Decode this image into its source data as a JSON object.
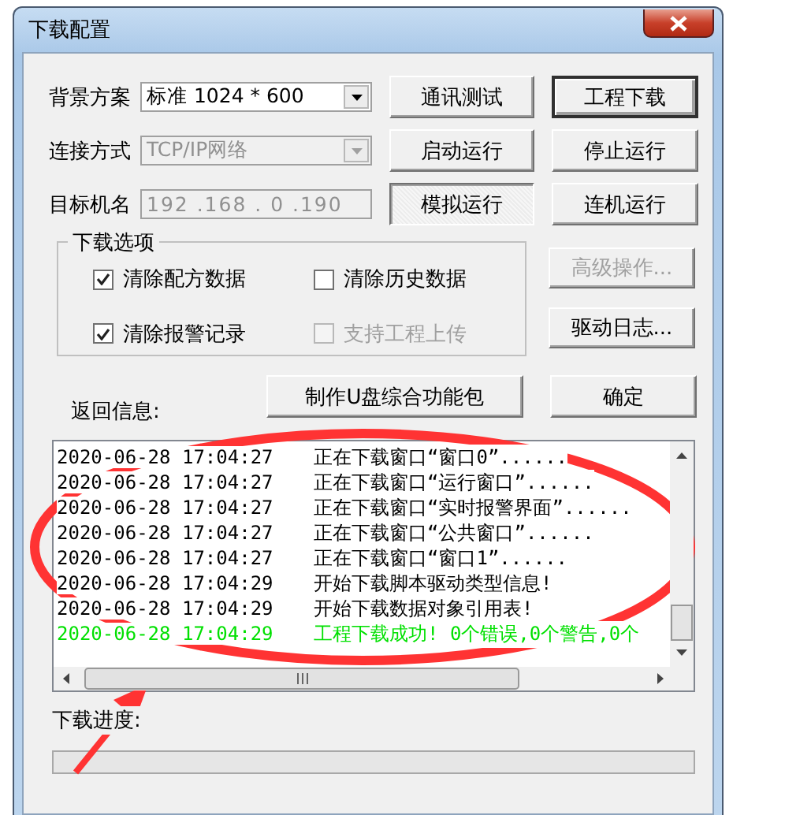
{
  "window": {
    "title": "下载配置"
  },
  "settings": [
    {
      "label": "背景方案",
      "kind": "combo",
      "value": "标准 1024 * 600",
      "disabled": false
    },
    {
      "label": "连接方式",
      "kind": "combo",
      "value": "TCP/IP网络",
      "disabled": true
    },
    {
      "label": "目标机名",
      "kind": "text",
      "value": "192 .168 . 0 .190",
      "disabled": true
    }
  ],
  "action_buttons": [
    {
      "label": "通讯测试",
      "disabled": false,
      "pressed": false,
      "default": false
    },
    {
      "label": "工程下载",
      "disabled": false,
      "pressed": false,
      "default": true
    },
    {
      "label": "启动运行",
      "disabled": false,
      "pressed": false,
      "default": false
    },
    {
      "label": "停止运行",
      "disabled": false,
      "pressed": false,
      "default": false
    },
    {
      "label": "模拟运行",
      "disabled": false,
      "pressed": true,
      "default": false
    },
    {
      "label": "连机运行",
      "disabled": false,
      "pressed": false,
      "default": false
    }
  ],
  "download_options": {
    "title": "下载选项",
    "options": [
      {
        "label": "清除配方数据",
        "checked": true,
        "disabled": false
      },
      {
        "label": "清除历史数据",
        "checked": false,
        "disabled": false
      },
      {
        "label": "清除报警记录",
        "checked": true,
        "disabled": false
      },
      {
        "label": "支持工程上传",
        "checked": false,
        "disabled": true
      }
    ]
  },
  "side_buttons": [
    {
      "label": "高级操作...",
      "disabled": true
    },
    {
      "label": "驱动日志...",
      "disabled": false
    }
  ],
  "usb_button": {
    "label": "制作U盘综合功能包"
  },
  "ok_button": {
    "label": "确定"
  },
  "log": {
    "label": "返回信息:",
    "entries": [
      {
        "time": "2020-06-28 17:04:27",
        "message": "正在下载窗口“窗口0”......",
        "kind": "info"
      },
      {
        "time": "2020-06-28 17:04:27",
        "message": "正在下载窗口“运行窗口”......",
        "kind": "info"
      },
      {
        "time": "2020-06-28 17:04:27",
        "message": "正在下载窗口“实时报警界面”......",
        "kind": "info"
      },
      {
        "time": "2020-06-28 17:04:27",
        "message": "正在下载窗口“公共窗口”......",
        "kind": "info"
      },
      {
        "time": "2020-06-28 17:04:27",
        "message": "正在下载窗口“窗口1”......",
        "kind": "info"
      },
      {
        "time": "2020-06-28 17:04:29",
        "message": "开始下载脚本驱动类型信息!",
        "kind": "info"
      },
      {
        "time": "2020-06-28 17:04:29",
        "message": "开始下载数据对象引用表!",
        "kind": "info"
      },
      {
        "time": "2020-06-28 17:04:29",
        "message": "工程下载成功! 0个错误,0个警告,0个",
        "kind": "success"
      }
    ]
  },
  "progress": {
    "label": "下载进度:",
    "level": 0
  }
}
